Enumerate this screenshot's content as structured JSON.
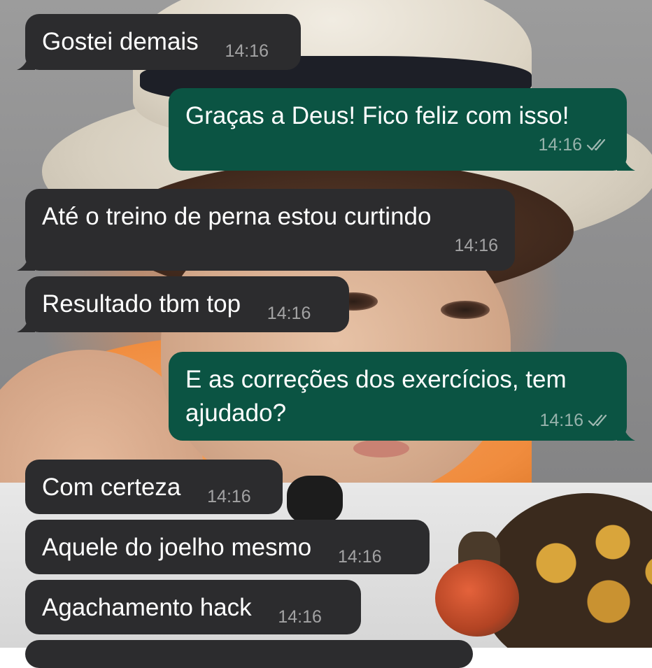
{
  "colors": {
    "incoming_bubble": "#2c2c2e",
    "outgoing_bubble": "#0b5443",
    "message_text": "#ffffff",
    "timestamp_text": "#a8a8a8"
  },
  "messages": [
    {
      "direction": "in",
      "text": "Gostei demais",
      "time": "14:16"
    },
    {
      "direction": "out",
      "text": "Graças a Deus! Fico feliz com isso!",
      "time": "14:16",
      "status_icon": "read-double-check-icon"
    },
    {
      "direction": "in",
      "text": "Até o treino de perna estou curtindo",
      "time": "14:16"
    },
    {
      "direction": "in",
      "text": "Resultado tbm top",
      "time": "14:16"
    },
    {
      "direction": "out",
      "text": "E as correções dos exercícios, tem ajudado?",
      "time": "14:16",
      "status_icon": "read-double-check-icon"
    },
    {
      "direction": "in",
      "text": "Com certeza",
      "time": "14:16"
    },
    {
      "direction": "in",
      "text": "Aquele do joelho mesmo",
      "time": "14:16"
    },
    {
      "direction": "in",
      "text": "Agachamento hack",
      "time": "14:16"
    }
  ]
}
